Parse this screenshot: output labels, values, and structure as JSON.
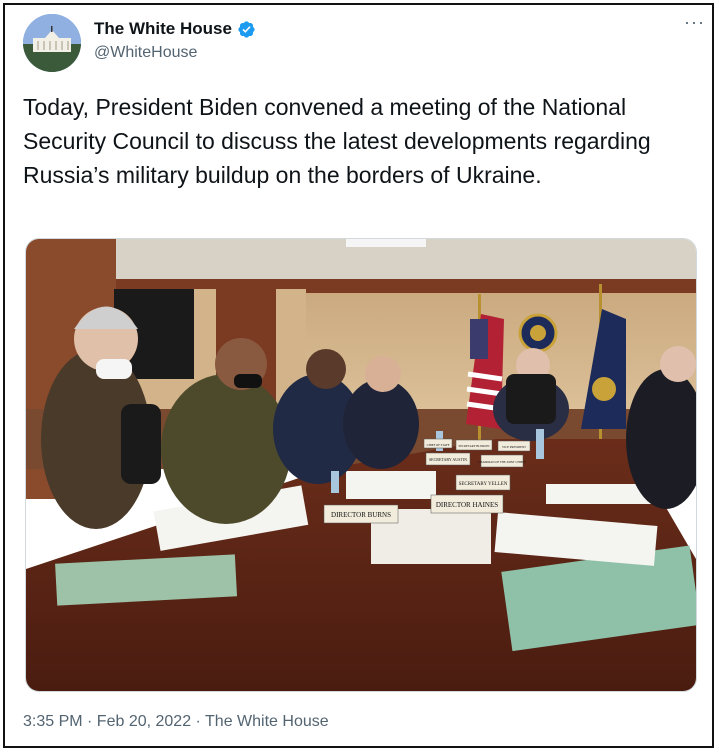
{
  "tweet": {
    "display_name": "The White House",
    "handle": "@WhiteHouse",
    "verified_icon": "verified-badge-icon",
    "more_icon": "more-dots-icon",
    "more_label": "···",
    "text": "Today, President Biden convened a meeting of the National Security Council to discuss the latest developments regarding Russia’s military buildup on the borders of Ukraine.",
    "timestamp": "3:35 PM · Feb 20, 2022 · The White House"
  },
  "photo": {
    "placards": [
      "DIRECTOR BURNS",
      "DIRECTOR HAINES",
      "SECRETARY YELLEN",
      "SECRETARY AUSTIN",
      "CHAIRMAN OF THE JOINT CHIEFS",
      "SECRETARY BLINKEN",
      "VICE PRESIDENT",
      "CHIEF OF STAFF"
    ]
  },
  "colors": {
    "text": "#0f1419",
    "secondary": "#536471",
    "verified": "#1d9bf0"
  }
}
